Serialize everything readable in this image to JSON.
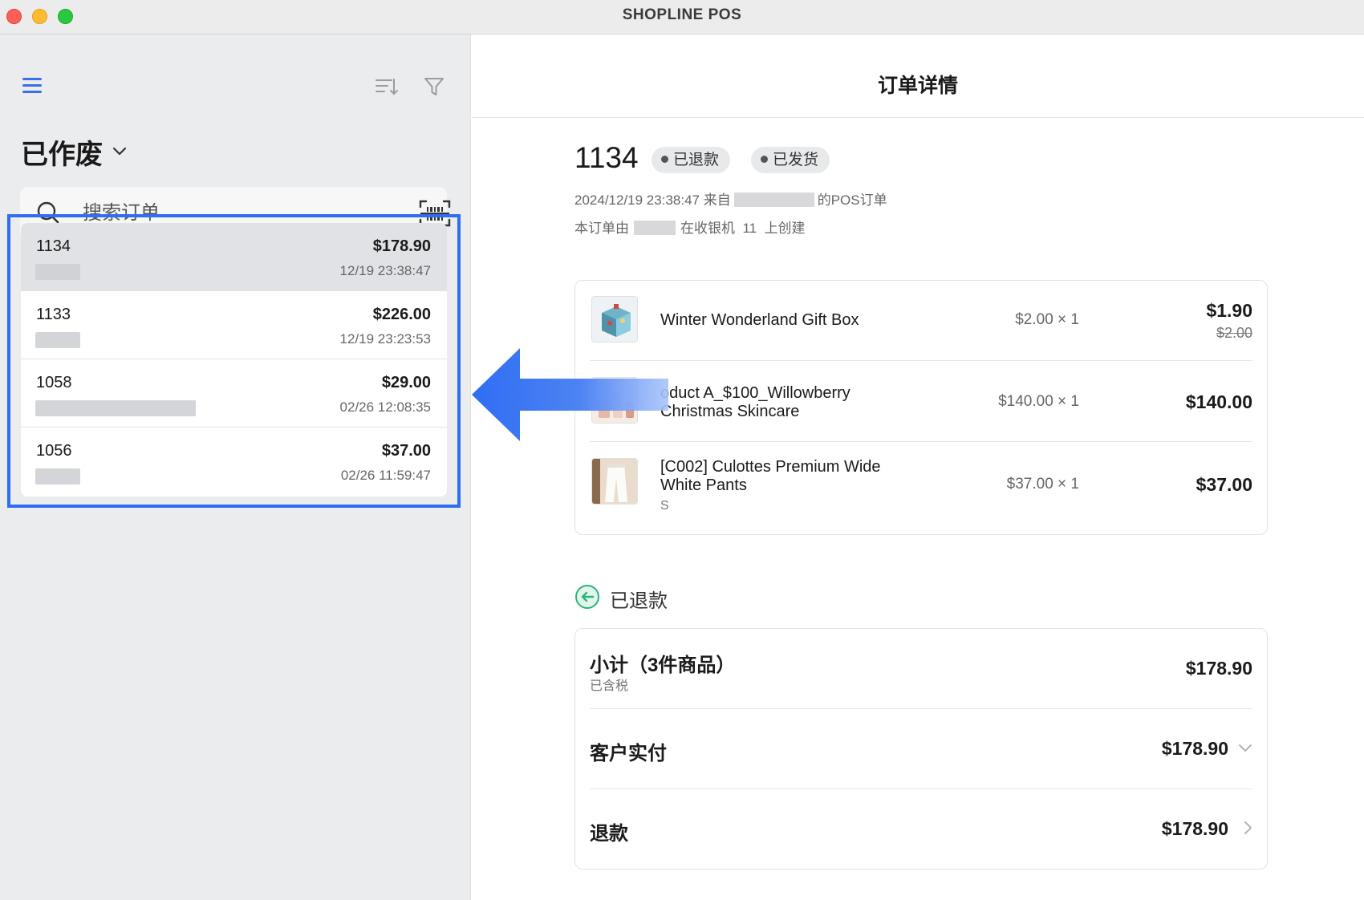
{
  "window": {
    "title": "SHOPLINE POS"
  },
  "sidebar": {
    "status_filter": "已作废",
    "search": {
      "placeholder": "搜索订单"
    },
    "orders": [
      {
        "number": "1134",
        "amount": "$178.90",
        "time": "12/19 23:38:47"
      },
      {
        "number": "1133",
        "amount": "$226.00",
        "time": "12/19 23:23:53"
      },
      {
        "number": "1058",
        "amount": "$29.00",
        "time": "02/26 12:08:35"
      },
      {
        "number": "1056",
        "amount": "$37.00",
        "time": "02/26 11:59:47"
      }
    ]
  },
  "detail": {
    "header_title": "订单详情",
    "order_number": "1134",
    "badges": [
      "已退款",
      "已发货"
    ],
    "meta_line1_prefix": "2024/12/19 23:38:47 来自",
    "meta_line1_suffix": "的POS订单",
    "meta_line2_prefix": "本订单由",
    "meta_line2_middle": "在收银机",
    "meta_line2_register": "11",
    "meta_line2_suffix": "上创建",
    "items": [
      {
        "name": "Winter Wonderland Gift Box",
        "qty": "$2.00 × 1",
        "total": "$1.90",
        "original": "$2.00"
      },
      {
        "name_line1": "oduct A_$100_Willowberry",
        "name_line2": "Christmas Skincare",
        "qty": "$140.00 × 1",
        "total": "$140.00"
      },
      {
        "name_line1": "[C002] Culottes Premium Wide",
        "name_line2": "White Pants",
        "variant": "S",
        "qty": "$37.00 × 1",
        "total": "$37.00"
      }
    ],
    "refund_status": "已退款",
    "summary": {
      "subtotal_label": "小计（3件商品）",
      "subtotal_note": "已含税",
      "subtotal_value": "$178.90",
      "paid_label": "客户实付",
      "paid_value": "$178.90",
      "refund_label": "退款",
      "refund_value": "$178.90"
    }
  },
  "colors": {
    "accent": "#2f6df3",
    "refund_icon": "#2db37a"
  },
  "icons": [
    "hamburger-menu-icon",
    "sort-icon",
    "filter-icon",
    "chevron-down-icon",
    "search-icon",
    "barcode-scan-icon",
    "back-arrow-icon",
    "chevron-right-icon"
  ]
}
